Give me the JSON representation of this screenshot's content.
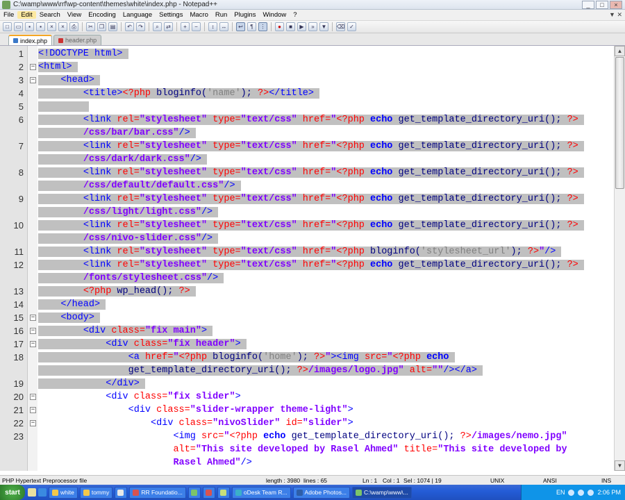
{
  "window": {
    "title": "C:\\wamp\\www\\rrf\\wp-content\\themes\\white\\index.php - Notepad++",
    "controls": [
      "_",
      "□",
      "×"
    ]
  },
  "menu": [
    "File",
    "Edit",
    "Search",
    "View",
    "Encoding",
    "Language",
    "Settings",
    "Macro",
    "Run",
    "Plugins",
    "Window",
    "?"
  ],
  "menu_active": "Edit",
  "doc_controls": "▼ ✕",
  "toolbar": {
    "buttons": [
      "new-icon",
      "open-icon",
      "save-icon",
      "save-all-icon",
      "close-icon",
      "close-all-icon",
      "print-icon",
      "sep",
      "cut-icon",
      "copy-icon",
      "paste-icon",
      "sep",
      "undo-icon",
      "redo-icon",
      "sep",
      "find-icon",
      "replace-icon",
      "sep",
      "zoom-in-icon",
      "zoom-out-icon",
      "sep",
      "sync-v-icon",
      "sync-h-icon",
      "sep",
      "wrap-icon",
      "all-chars-icon",
      "indent-guide-icon",
      "sep",
      "record-icon",
      "stop-icon",
      "play-icon",
      "play-multi-icon",
      "save-macro-icon",
      "sep",
      "trim-icon",
      "spell-icon"
    ]
  },
  "tabs": [
    {
      "label": "index.php",
      "active": true
    },
    {
      "label": "header.php",
      "active": false
    }
  ],
  "editor": {
    "lines": [
      {
        "n": "1",
        "fold": "",
        "sel": true,
        "ind": 0,
        "parts": [
          [
            "t-tag",
            "<!DOCTYPE html>"
          ]
        ]
      },
      {
        "n": "2",
        "fold": "⊟",
        "sel": true,
        "ind": 0,
        "parts": [
          [
            "t-tag",
            "<html>"
          ]
        ]
      },
      {
        "n": "3",
        "fold": "⊟",
        "sel": true,
        "ind": 1,
        "parts": [
          [
            "t-tag",
            "<head>"
          ]
        ]
      },
      {
        "n": "4",
        "fold": "",
        "sel": true,
        "ind": 2,
        "parts": [
          [
            "t-tag",
            "<title>"
          ],
          [
            "t-php",
            "<?php "
          ],
          [
            "t-fn",
            "bloginfo("
          ],
          [
            "t-strs",
            "'name'"
          ],
          [
            "t-fn",
            "); "
          ],
          [
            "t-php",
            "?>"
          ],
          [
            "t-tag",
            "</title>"
          ]
        ]
      },
      {
        "n": "5",
        "fold": "",
        "sel": true,
        "ind": 2,
        "parts": []
      },
      {
        "n": "6",
        "fold": "",
        "sel": true,
        "ind": 2,
        "parts": [
          [
            "t-tag",
            "<link "
          ],
          [
            "t-attr",
            "rel="
          ],
          [
            "t-str",
            "\"stylesheet\""
          ],
          [
            "t-attr",
            " type="
          ],
          [
            "t-str",
            "\"text/css\""
          ],
          [
            "t-attr",
            " href="
          ],
          [
            "t-str",
            "\""
          ],
          [
            "t-php",
            "<?php "
          ],
          [
            "t-kw",
            "echo"
          ],
          [
            "t-fn",
            " get_template_directory_uri(); "
          ],
          [
            "t-php",
            "?>"
          ]
        ]
      },
      {
        "n": "",
        "fold": "",
        "sel": true,
        "ind": 2,
        "parts": [
          [
            "t-str",
            "/css/bar/bar.css\""
          ],
          [
            "t-tag",
            "/>"
          ]
        ]
      },
      {
        "n": "7",
        "fold": "",
        "sel": true,
        "ind": 2,
        "parts": [
          [
            "t-tag",
            "<link "
          ],
          [
            "t-attr",
            "rel="
          ],
          [
            "t-str",
            "\"stylesheet\""
          ],
          [
            "t-attr",
            " type="
          ],
          [
            "t-str",
            "\"text/css\""
          ],
          [
            "t-attr",
            " href="
          ],
          [
            "t-str",
            "\""
          ],
          [
            "t-php",
            "<?php "
          ],
          [
            "t-kw",
            "echo"
          ],
          [
            "t-fn",
            " get_template_directory_uri(); "
          ],
          [
            "t-php",
            "?>"
          ]
        ]
      },
      {
        "n": "",
        "fold": "",
        "sel": true,
        "ind": 2,
        "parts": [
          [
            "t-str",
            "/css/dark/dark.css\""
          ],
          [
            "t-tag",
            "/>"
          ]
        ]
      },
      {
        "n": "8",
        "fold": "",
        "sel": true,
        "ind": 2,
        "parts": [
          [
            "t-tag",
            "<link "
          ],
          [
            "t-attr",
            "rel="
          ],
          [
            "t-str",
            "\"stylesheet\""
          ],
          [
            "t-attr",
            " type="
          ],
          [
            "t-str",
            "\"text/css\""
          ],
          [
            "t-attr",
            " href="
          ],
          [
            "t-str",
            "\""
          ],
          [
            "t-php",
            "<?php "
          ],
          [
            "t-kw",
            "echo"
          ],
          [
            "t-fn",
            " get_template_directory_uri(); "
          ],
          [
            "t-php",
            "?>"
          ]
        ]
      },
      {
        "n": "",
        "fold": "",
        "sel": true,
        "ind": 2,
        "parts": [
          [
            "t-str",
            "/css/default/default.css\""
          ],
          [
            "t-tag",
            "/>"
          ]
        ]
      },
      {
        "n": "9",
        "fold": "",
        "sel": true,
        "ind": 2,
        "parts": [
          [
            "t-tag",
            "<link "
          ],
          [
            "t-attr",
            "rel="
          ],
          [
            "t-str",
            "\"stylesheet\""
          ],
          [
            "t-attr",
            " type="
          ],
          [
            "t-str",
            "\"text/css\""
          ],
          [
            "t-attr",
            " href="
          ],
          [
            "t-str",
            "\""
          ],
          [
            "t-php",
            "<?php "
          ],
          [
            "t-kw",
            "echo"
          ],
          [
            "t-fn",
            " get_template_directory_uri(); "
          ],
          [
            "t-php",
            "?>"
          ]
        ]
      },
      {
        "n": "",
        "fold": "",
        "sel": true,
        "ind": 2,
        "parts": [
          [
            "t-str",
            "/css/light/light.css\""
          ],
          [
            "t-tag",
            "/>"
          ]
        ]
      },
      {
        "n": "10",
        "fold": "",
        "sel": true,
        "ind": 2,
        "parts": [
          [
            "t-tag",
            "<link "
          ],
          [
            "t-attr",
            "rel="
          ],
          [
            "t-str",
            "\"stylesheet\""
          ],
          [
            "t-attr",
            " type="
          ],
          [
            "t-str",
            "\"text/css\""
          ],
          [
            "t-attr",
            " href="
          ],
          [
            "t-str",
            "\""
          ],
          [
            "t-php",
            "<?php "
          ],
          [
            "t-kw",
            "echo"
          ],
          [
            "t-fn",
            " get_template_directory_uri(); "
          ],
          [
            "t-php",
            "?>"
          ]
        ]
      },
      {
        "n": "",
        "fold": "",
        "sel": true,
        "ind": 2,
        "parts": [
          [
            "t-str",
            "/css/nivo-slider.css\""
          ],
          [
            "t-tag",
            "/>"
          ]
        ]
      },
      {
        "n": "11",
        "fold": "",
        "sel": true,
        "ind": 2,
        "parts": [
          [
            "t-tag",
            "<link "
          ],
          [
            "t-attr",
            "rel="
          ],
          [
            "t-str",
            "\"stylesheet\""
          ],
          [
            "t-attr",
            " type="
          ],
          [
            "t-str",
            "\"text/css\""
          ],
          [
            "t-attr",
            " href="
          ],
          [
            "t-str",
            "\""
          ],
          [
            "t-php",
            "<?php "
          ],
          [
            "t-fn",
            "bloginfo("
          ],
          [
            "t-strs",
            "'stylesheet_url'"
          ],
          [
            "t-fn",
            "); "
          ],
          [
            "t-php",
            "?>"
          ],
          [
            "t-str",
            "\""
          ],
          [
            "t-tag",
            "/>"
          ]
        ]
      },
      {
        "n": "12",
        "fold": "",
        "sel": true,
        "ind": 2,
        "parts": [
          [
            "t-tag",
            "<link "
          ],
          [
            "t-attr",
            "rel="
          ],
          [
            "t-str",
            "\"stylesheet\""
          ],
          [
            "t-attr",
            " type="
          ],
          [
            "t-str",
            "\"text/css\""
          ],
          [
            "t-attr",
            " href="
          ],
          [
            "t-str",
            "\""
          ],
          [
            "t-php",
            "<?php "
          ],
          [
            "t-kw",
            "echo"
          ],
          [
            "t-fn",
            " get_template_directory_uri(); "
          ],
          [
            "t-php",
            "?>"
          ]
        ]
      },
      {
        "n": "",
        "fold": "",
        "sel": true,
        "ind": 2,
        "parts": [
          [
            "t-str",
            "/fonts/stylesheet.css\""
          ],
          [
            "t-tag",
            "/>"
          ]
        ]
      },
      {
        "n": "13",
        "fold": "",
        "sel": true,
        "ind": 2,
        "parts": [
          [
            "t-php",
            "<?php "
          ],
          [
            "t-fn",
            "wp_head(); "
          ],
          [
            "t-php",
            "?>"
          ]
        ]
      },
      {
        "n": "14",
        "fold": "",
        "sel": true,
        "ind": 1,
        "parts": [
          [
            "t-tag",
            "</head>"
          ]
        ]
      },
      {
        "n": "15",
        "fold": "⊟",
        "sel": true,
        "ind": 1,
        "parts": [
          [
            "t-tag",
            "<body>"
          ]
        ]
      },
      {
        "n": "16",
        "fold": "⊟",
        "sel": true,
        "ind": 2,
        "parts": [
          [
            "t-tag",
            "<div "
          ],
          [
            "t-attr",
            "class="
          ],
          [
            "t-str",
            "\"fix main\""
          ],
          [
            "t-tag",
            ">"
          ]
        ]
      },
      {
        "n": "17",
        "fold": "⊟",
        "sel": true,
        "ind": 3,
        "parts": [
          [
            "t-tag",
            "<div "
          ],
          [
            "t-attr",
            "class="
          ],
          [
            "t-str",
            "\"fix header\""
          ],
          [
            "t-tag",
            ">"
          ]
        ]
      },
      {
        "n": "18",
        "fold": "",
        "sel": true,
        "ind": 4,
        "parts": [
          [
            "t-tag",
            "<a "
          ],
          [
            "t-attr",
            "href="
          ],
          [
            "t-str",
            "\""
          ],
          [
            "t-php",
            "<?php "
          ],
          [
            "t-fn",
            "bloginfo("
          ],
          [
            "t-strs",
            "'home'"
          ],
          [
            "t-fn",
            "); "
          ],
          [
            "t-php",
            "?>"
          ],
          [
            "t-str",
            "\""
          ],
          [
            "t-tag",
            "><img "
          ],
          [
            "t-attr",
            "src="
          ],
          [
            "t-str",
            "\""
          ],
          [
            "t-php",
            "<?php "
          ],
          [
            "t-kw",
            "echo"
          ]
        ]
      },
      {
        "n": "",
        "fold": "",
        "sel": true,
        "ind": 4,
        "parts": [
          [
            "t-fn",
            "get_template_directory_uri(); "
          ],
          [
            "t-php",
            "?>"
          ],
          [
            "t-str",
            "/images/logo.jpg\""
          ],
          [
            "t-attr",
            " alt="
          ],
          [
            "t-str",
            "\"\""
          ],
          [
            "t-tag",
            "/></a>"
          ]
        ]
      },
      {
        "n": "19",
        "fold": "",
        "sel": true,
        "ind": 3,
        "parts": [
          [
            "t-tag",
            "</div>"
          ]
        ]
      },
      {
        "n": "20",
        "fold": "⊟",
        "sel": false,
        "ind": 3,
        "parts": [
          [
            "t-tag",
            "<div "
          ],
          [
            "t-attr",
            "class="
          ],
          [
            "t-str",
            "\"fix slider\""
          ],
          [
            "t-tag",
            ">"
          ]
        ]
      },
      {
        "n": "21",
        "fold": "⊟",
        "sel": false,
        "ind": 4,
        "parts": [
          [
            "t-tag",
            "<div "
          ],
          [
            "t-attr",
            "class="
          ],
          [
            "t-str",
            "\"slider-wrapper theme-light\""
          ],
          [
            "t-tag",
            ">"
          ]
        ]
      },
      {
        "n": "22",
        "fold": "⊟",
        "sel": false,
        "ind": 5,
        "parts": [
          [
            "t-tag",
            "<div "
          ],
          [
            "t-attr",
            "class="
          ],
          [
            "t-str",
            "\"nivoSlider\""
          ],
          [
            "t-attr",
            " id="
          ],
          [
            "t-str",
            "\"slider\""
          ],
          [
            "t-tag",
            ">"
          ]
        ]
      },
      {
        "n": "23",
        "fold": "",
        "sel": false,
        "ind": 6,
        "parts": [
          [
            "t-tag",
            "<img "
          ],
          [
            "t-attr",
            "src="
          ],
          [
            "t-str",
            "\""
          ],
          [
            "t-php",
            "<?php "
          ],
          [
            "t-kw",
            "echo"
          ],
          [
            "t-fn",
            " get_template_directory_uri(); "
          ],
          [
            "t-php",
            "?>"
          ],
          [
            "t-str",
            "/images/nemo.jpg\""
          ]
        ]
      },
      {
        "n": "",
        "fold": "",
        "sel": false,
        "ind": 6,
        "parts": [
          [
            "t-attr",
            "alt="
          ],
          [
            "t-str",
            "\"This site developed by Rasel Ahmed\""
          ],
          [
            "t-attr",
            " title="
          ],
          [
            "t-str",
            "\"This site developed by"
          ]
        ]
      },
      {
        "n": "",
        "fold": "",
        "sel": false,
        "ind": 6,
        "parts": [
          [
            "t-str",
            "Rasel Ahmed\""
          ],
          [
            "t-tag",
            "/>"
          ]
        ]
      }
    ]
  },
  "status": {
    "filetype": "PHP Hypertext Preprocessor file",
    "length": "length : 3980",
    "lines": "lines : 65",
    "ln": "Ln : 1",
    "col": "Col : 1",
    "sel": "Sel : 1074 | 19",
    "eol": "UNIX",
    "encoding": "ANSI",
    "mode": "INS"
  },
  "taskbar": {
    "start": "start",
    "tasks": [
      {
        "label": "white",
        "active": false
      },
      {
        "label": "tommy",
        "active": false
      },
      {
        "label": "",
        "active": false
      },
      {
        "label": "RR Foundatio...",
        "active": false
      },
      {
        "label": "",
        "active": false
      },
      {
        "label": "",
        "active": false
      },
      {
        "label": "",
        "active": false
      },
      {
        "label": "oDesk Team R...",
        "active": false
      },
      {
        "label": "Adobe Photos...",
        "active": false
      },
      {
        "label": "C:\\wamp\\www\\...",
        "active": true
      }
    ],
    "lang": "EN",
    "clock": "2:06 PM"
  }
}
